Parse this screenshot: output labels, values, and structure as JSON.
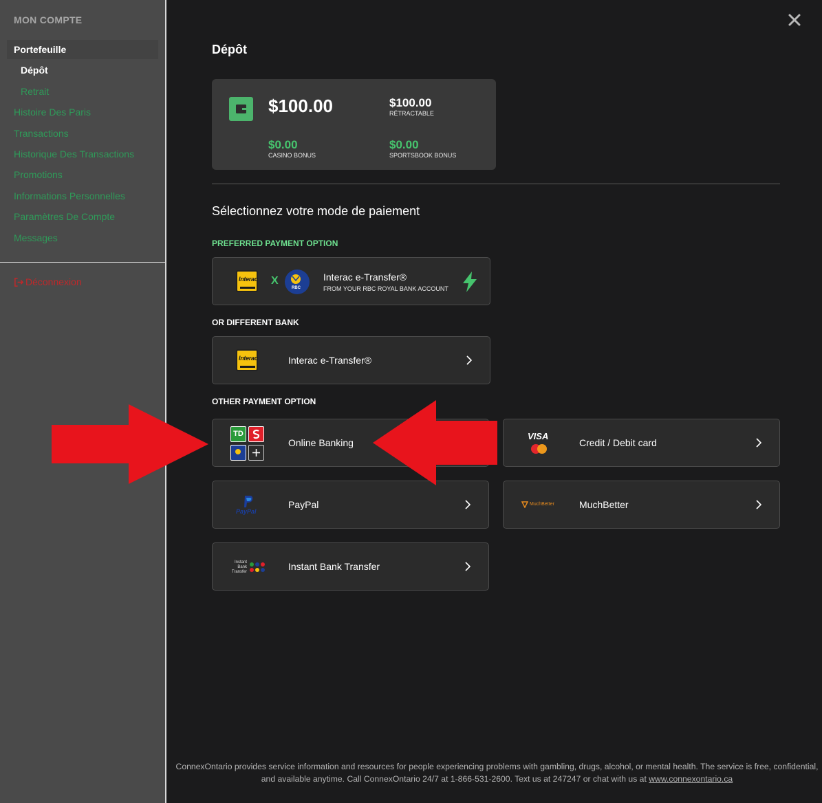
{
  "sidebar": {
    "title": "MON COMPTE",
    "items": [
      {
        "label": "Portefeuille"
      },
      {
        "label": "Dépôt"
      },
      {
        "label": "Retrait"
      },
      {
        "label": "Histoire Des Paris"
      },
      {
        "label": "Transactions"
      },
      {
        "label": "Historique Des Transactions"
      },
      {
        "label": "Promotions"
      },
      {
        "label": "Informations Personnelles"
      },
      {
        "label": "Paramètres De Compte"
      },
      {
        "label": "Messages"
      }
    ],
    "logout": "Déconnexion"
  },
  "header": {
    "title": "Dépôt"
  },
  "balance": {
    "total": "$100.00",
    "withdrawable_value": "$100.00",
    "withdrawable_label": "RÉTRACTABLE",
    "casino_value": "$0.00",
    "casino_label": "CASINO BONUS",
    "sportsbook_value": "$0.00",
    "sportsbook_label": "SPORTSBOOK BONUS"
  },
  "payment": {
    "heading": "Sélectionnez votre mode de paiement",
    "preferred_label": "PREFERRED PAYMENT OPTION",
    "preferred": {
      "x": "X",
      "title": "Interac e-Transfer®",
      "subtitle": "FROM YOUR RBC ROYAL BANK ACCOUNT",
      "interac_logo": "Interac",
      "rbc_logo": "RBC"
    },
    "different_label": "OR DIFFERENT BANK",
    "interac_card": {
      "label": "Interac e-Transfer®"
    },
    "other_label": "OTHER PAYMENT OPTION",
    "options": [
      {
        "label": "Online Banking",
        "td_logo": "TD"
      },
      {
        "label": "Credit / Debit card",
        "visa_logo": "VISA"
      },
      {
        "label": "PayPal",
        "paypal_logo": "PayPal"
      },
      {
        "label": "MuchBetter",
        "mb_logo": "MuchBetter"
      },
      {
        "label": "Instant Bank Transfer",
        "ibt_logo_1": "Instant",
        "ibt_logo_2": "Bank",
        "ibt_logo_3": "Transfer"
      }
    ]
  },
  "footer": {
    "text": "ConnexOntario provides service information and resources for people experiencing problems with gambling, drugs, alcohol, or mental health. The service is free, confidential, and available anytime. Call ConnexOntario 24/7 at 1-866-531-2600. Text us at 247247 or chat with us at",
    "link": "www.connexontario.ca"
  },
  "colors": {
    "accent_green": "#46c36d",
    "link_green": "#2f9a59",
    "logout_red": "#c0282a",
    "arrow_red": "#e8141c"
  }
}
